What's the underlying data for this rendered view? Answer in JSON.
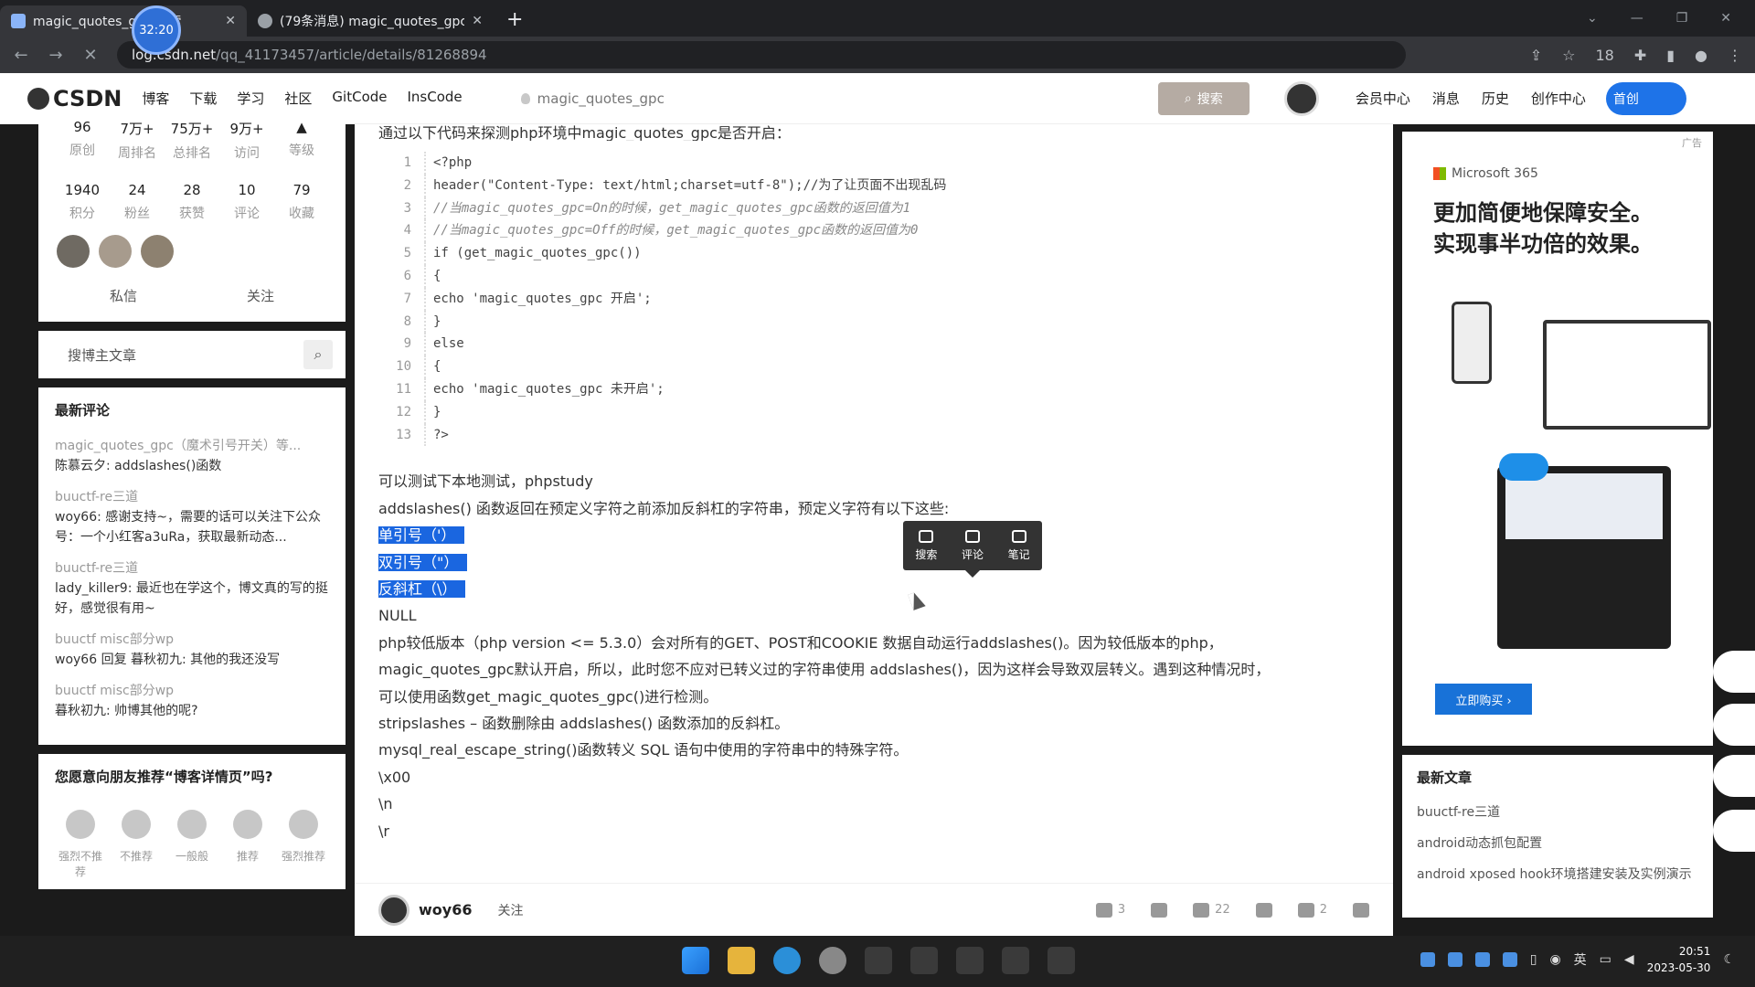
{
  "browser": {
    "tabs": [
      {
        "title": "magic_quotes_gpc 搜索",
        "active": true
      },
      {
        "title": "(79条消息) magic_quotes_gpc",
        "active": false
      }
    ],
    "timer": "32:20",
    "url_host": "log.csdn.net",
    "url_path": "/qq_41173457/article/details/81268894",
    "ext_badge": "18"
  },
  "csdn": {
    "logo": "CSDN",
    "nav": [
      "博客",
      "下载",
      "学习",
      "社区",
      "GitCode",
      "InsCode"
    ],
    "breadcrumb": "magic_quotes_gpc",
    "search_btn": "搜索",
    "right_nav": [
      "会员中心",
      "消息",
      "历史",
      "创作中心"
    ],
    "create_btn": "首创"
  },
  "profile": {
    "row1_nums": [
      "96",
      "7万+",
      "75万+",
      "9万+",
      ""
    ],
    "row1_labels": [
      "原创",
      "周排名",
      "总排名",
      "访问",
      "等级"
    ],
    "row2_nums": [
      "1940",
      "24",
      "28",
      "10",
      "79"
    ],
    "row2_labels": [
      "积分",
      "粉丝",
      "获赞",
      "评论",
      "收藏"
    ],
    "actions": [
      "私信",
      "关注"
    ]
  },
  "blog_search": {
    "placeholder": "搜博主文章"
  },
  "latest_comments": {
    "title": "最新评论",
    "items": [
      {
        "article": "magic_quotes_gpc（魔术引号开关）等...",
        "text": "陈慕云夕: addslashes()函数"
      },
      {
        "article": "buuctf-re三道",
        "text": "woy66: 感谢支持~，需要的话可以关注下公众号：一个小红客a3uRa，获取最新动态..."
      },
      {
        "article": "buuctf-re三道",
        "text": "lady_killer9: 最近也在学这个，博文真的写的挺好，感觉很有用~"
      },
      {
        "article": "buuctf misc部分wp",
        "text": "woy66 回复 暮秋初九: 其他的我还没写"
      },
      {
        "article": "buuctf misc部分wp",
        "text": "暮秋初九: 帅博其他的呢?"
      }
    ]
  },
  "recommend": {
    "title": "您愿意向朋友推荐“博客详情页”吗?",
    "options": [
      "强烈不推荐",
      "不推荐",
      "一般般",
      "推荐",
      "强烈推荐"
    ]
  },
  "article": {
    "intro": "通过以下代码来探测php环境中magic_quotes_gpc是否开启：",
    "code": [
      "<?php",
      "header(\"Content-Type: text/html;charset=utf-8\");//为了让页面不出现乱码",
      "//当magic_quotes_gpc=On的时候，get_magic_quotes_gpc函数的返回值为1",
      "//当magic_quotes_gpc=Off的时候，get_magic_quotes_gpc函数的返回值为0",
      "if (get_magic_quotes_gpc())",
      "{",
      "echo 'magic_quotes_gpc 开启';",
      "}",
      "else",
      "{",
      "echo 'magic_quotes_gpc 未开启';",
      "}",
      "?>"
    ],
    "line_numbers": [
      "1",
      "2",
      "3",
      "4",
      "5",
      "6",
      "7",
      "8",
      "9",
      "10",
      "11",
      "12",
      "13"
    ],
    "prose": [
      "可以测试下本地测试，phpstudy",
      "addslashes() 函数返回在预定义字符之前添加反斜杠的字符串，预定义字符有以下这些:",
      "单引号（'）",
      "双引号（\"）",
      "反斜杠（\\）",
      "NULL",
      "php较低版本（php version <= 5.3.0）会对所有的GET、POST和COOKIE 数据自动运行addslashes()。因为较低版本的php，",
      "magic_quotes_gpc默认开启，所以，此时您不应对已转义过的字符串使用 addslashes()，因为这样会导致双层转义。遇到这种情况时，",
      "可以使用函数get_magic_quotes_gpc()进行检测。",
      "stripslashes – 函数删除由 addslashes() 函数添加的反斜杠。",
      "mysql_real_escape_string()函数转义 SQL 语句中使用的字符串中的特殊字符。",
      "\\x00",
      "\\n",
      "\\r"
    ],
    "popup": [
      "搜索",
      "评论",
      "笔记"
    ]
  },
  "footer": {
    "author": "woy66",
    "follow": "关注",
    "likes": "3",
    "stars": "22",
    "comments": "2"
  },
  "ad": {
    "label": "广告",
    "brand": "Microsoft 365",
    "headline1": "更加简便地保障安全。",
    "headline2": "实现事半功倍的效果。",
    "button": "立即购买 ›"
  },
  "latest_articles": {
    "title": "最新文章",
    "items": [
      "buuctf-re三道",
      "android动态抓包配置",
      "android xposed hook环境搭建安装及实例演示"
    ]
  },
  "taskbar": {
    "time": "20:51",
    "date": "2023-05-30",
    "ime": "英"
  },
  "colors": {
    "accent": "#1e73e8",
    "selection": "#1a66e0"
  }
}
